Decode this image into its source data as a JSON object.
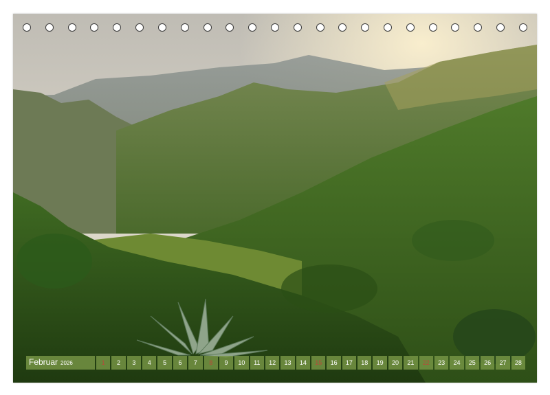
{
  "calendar": {
    "month": "Februar",
    "year": "2026",
    "days": [
      "1",
      "2",
      "3",
      "4",
      "5",
      "6",
      "7",
      "8",
      "9",
      "10",
      "11",
      "12",
      "13",
      "14",
      "15",
      "16",
      "17",
      "18",
      "19",
      "20",
      "21",
      "22",
      "23",
      "24",
      "25",
      "26",
      "27",
      "28"
    ],
    "sundays": [
      "1",
      "8",
      "15",
      "22"
    ]
  },
  "binding": {
    "ring_count": 23
  },
  "photo": {
    "icon": "mountain-landscape-photo"
  },
  "colors": {
    "calendar_bar": "#789646",
    "sunday_text": "#b84a3a",
    "ring_border": "#3a3a3a"
  }
}
